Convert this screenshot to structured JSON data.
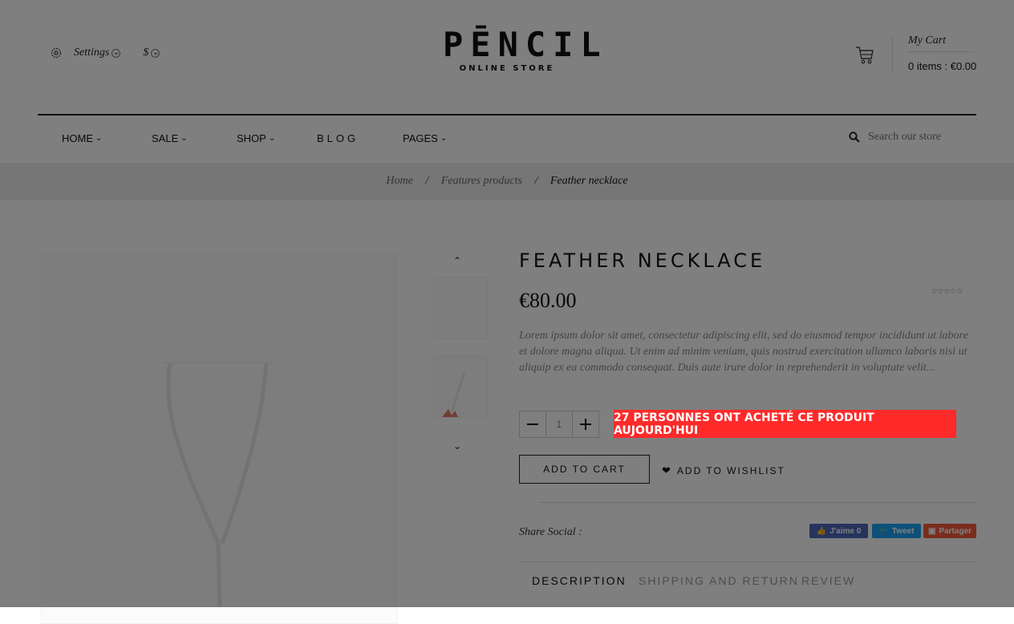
{
  "header": {
    "settings_label": "Settings",
    "currency_label": "$",
    "logo_main": "PĒNCIL",
    "logo_sub": "ONLINE STORE",
    "cart_title": "My Cart",
    "cart_summary": "0 items : €0.00"
  },
  "nav": {
    "items": [
      {
        "label": "HOME"
      },
      {
        "label": "SALE"
      },
      {
        "label": "SHOP"
      },
      {
        "label": "BLOG"
      },
      {
        "label": "PAGES"
      }
    ],
    "search_placeholder": "Search our store"
  },
  "breadcrumb": {
    "home": "Home",
    "parent": "Features products",
    "current": "Feather necklace",
    "separator": "/"
  },
  "product": {
    "title": "FEATHER NECKLACE",
    "price": "€80.00",
    "stars": "☆☆☆☆☆",
    "description": "Lorem ipsum dolor sit amet, consectetur adipiscing elit, sed do eiusmod tempor incididunt ut labore et dolore magna aliqua. Ut enim ad minim veniam, quis nostrud exercitation ullamco laboris nisi ut aliquip ex ea commodo consequat. Duis aute irure dolor in reprehenderit in voluptate velit...",
    "quantity": "1",
    "promo_banner": "27 PERSONNES ONT ACHETÉ CE PRODUIT AUJOURD'HUI",
    "add_to_cart": "ADD TO CART",
    "add_to_wishlist": "ADD TO WISHLIST",
    "share_label": "Share Social :",
    "share_facebook": "J'aime 0",
    "share_twitter": "Tweet",
    "share_pinterest": "Partager",
    "tabs": [
      {
        "label": "DESCRIPTION",
        "active": true
      },
      {
        "label": "SHIPPING AND RETURN",
        "active": false
      },
      {
        "label": "REVIEW",
        "active": false
      }
    ]
  },
  "colors": {
    "overlay": "rgba(0,0,0,0.5)",
    "promo_bg": "#ff2a2a",
    "facebook": "#4c69ba",
    "twitter": "#1da1f2",
    "pinterest": "#f65a3b",
    "logo_accent": "#e03c31"
  }
}
